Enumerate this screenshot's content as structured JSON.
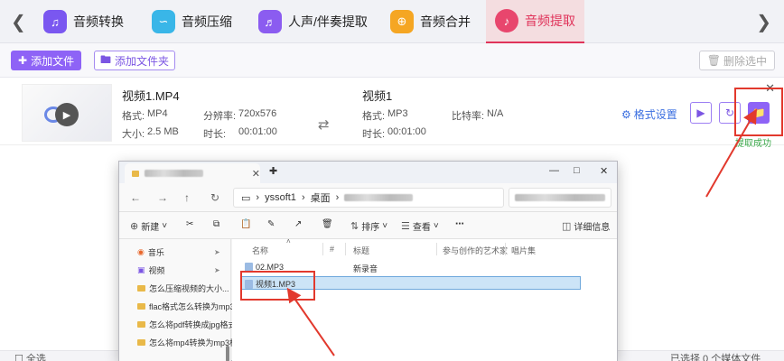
{
  "tabs": [
    {
      "label": "音频转换",
      "icon": "headphones-icon",
      "color": "#7a57f0"
    },
    {
      "label": "音频压缩",
      "icon": "waveform-icon",
      "color": "#39b6e8"
    },
    {
      "label": "人声/伴奏提取",
      "icon": "voice-icon",
      "color": "#8b5cf0"
    },
    {
      "label": "音频合并",
      "icon": "merge-icon",
      "color": "#f5a623"
    },
    {
      "label": "音频提取",
      "icon": "microphone-icon",
      "color": "#e8466d",
      "active": true
    }
  ],
  "toolbar": {
    "add_file": "添加文件",
    "add_folder": "添加文件夹",
    "delete_selected": "删除选中"
  },
  "file": {
    "source_name": "视频1.MP4",
    "source_format_label": "格式:",
    "source_format": "MP4",
    "source_resolution_label": "分辨率:",
    "source_resolution": "720x576",
    "source_size_label": "大小:",
    "source_size": "2.5 MB",
    "source_duration_label": "时长:",
    "source_duration": "00:01:00",
    "target_name": "视频1",
    "target_format_label": "格式:",
    "target_format": "MP3",
    "target_bitrate_label": "比特率:",
    "target_bitrate": "N/A",
    "target_duration_label": "时长:",
    "target_duration": "00:01:00",
    "format_settings": "格式设置",
    "status": "提取成功"
  },
  "bottom": {
    "select_all": "全选",
    "selected_info": "已选择 0 个媒体文件"
  },
  "explorer": {
    "address": [
      "yssoft1",
      "桌面"
    ],
    "cmd": {
      "new": "新建",
      "sort": "排序",
      "view": "查看",
      "details": "详细信息"
    },
    "columns": [
      "名称",
      "#",
      "标题",
      "参与创作的艺术家",
      "唱片集"
    ],
    "sidebar": [
      {
        "label": "音乐",
        "icon": "music-icon",
        "pinned": true
      },
      {
        "label": "视频",
        "icon": "video-icon",
        "pinned": true
      },
      {
        "label": "怎么压缩视频的大小...",
        "icon": "folder-icon"
      },
      {
        "label": "flac格式怎么转换为mp3",
        "icon": "folder-icon"
      },
      {
        "label": "怎么将pdf转换成jpg格式",
        "icon": "folder-icon"
      },
      {
        "label": "怎么将mp4转换为mp3格",
        "icon": "folder-icon"
      }
    ],
    "files": [
      {
        "name": "02.MP3",
        "title": "新录音"
      },
      {
        "name": "视频1.MP3",
        "title": "",
        "selected": true
      }
    ]
  },
  "colors": {
    "accent": "#8e63f6",
    "active_tab": "#e0335a",
    "highlight_red": "#e2392d",
    "success": "#3aa84a"
  }
}
